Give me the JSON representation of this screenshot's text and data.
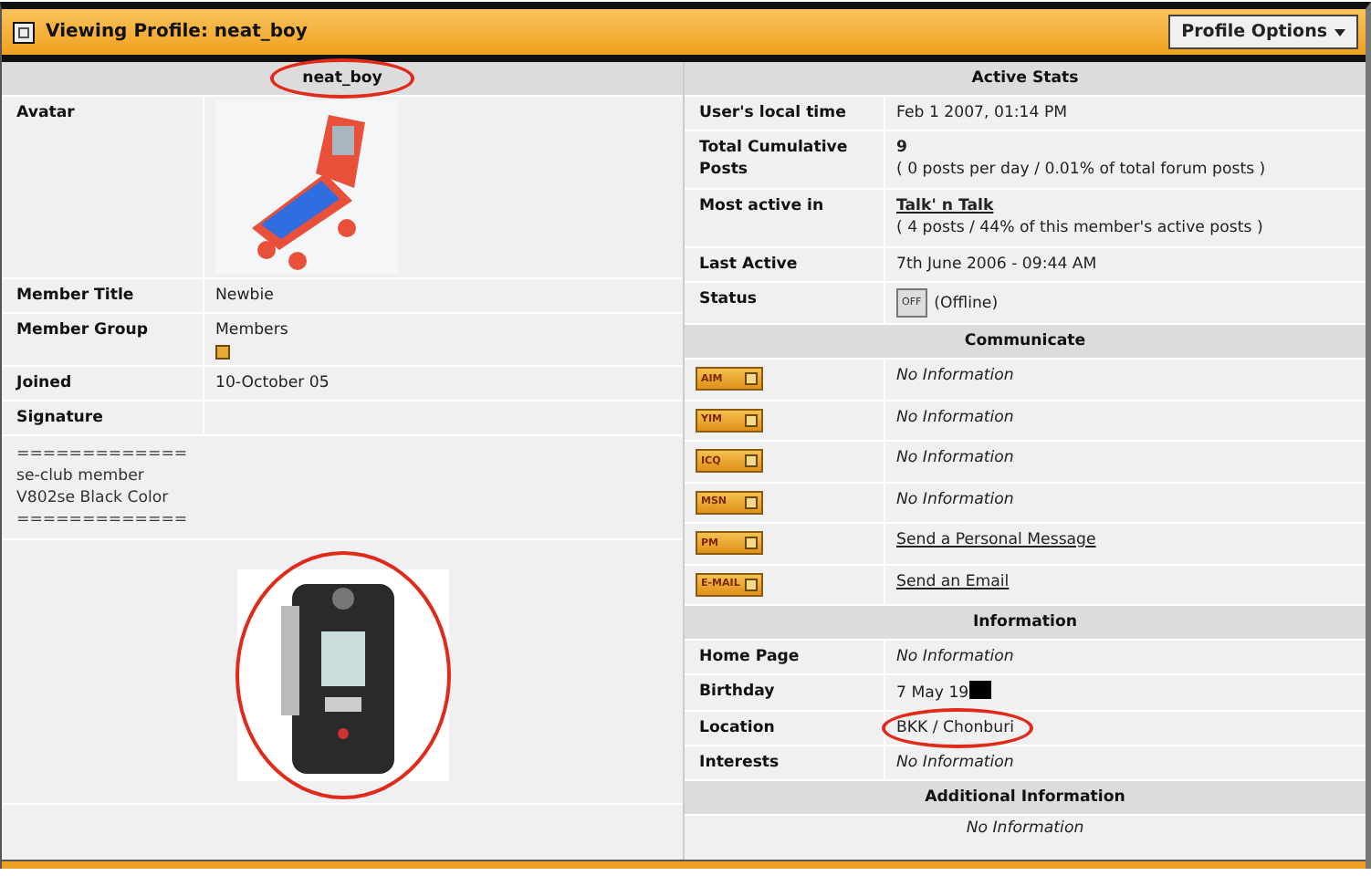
{
  "header": {
    "title": "Viewing Profile: neat_boy",
    "options_button": "Profile Options"
  },
  "profile": {
    "username": "neat_boy",
    "username_circled": true,
    "rows": [
      {
        "kind": "avatar",
        "label": "Avatar"
      },
      {
        "kind": "text",
        "label": "Member Title",
        "value": "Newbie"
      },
      {
        "kind": "group",
        "label": "Member Group",
        "value": "Members"
      },
      {
        "kind": "text",
        "label": "Joined",
        "value": "10-October 05"
      },
      {
        "kind": "label",
        "label": "Signature"
      }
    ],
    "signature_lines": [
      "=============",
      "se-club member",
      "V802se Black Color",
      "============="
    ],
    "signature_image": {
      "circled": true
    }
  },
  "active_stats": {
    "title": "Active Stats",
    "rows": [
      {
        "kind": "text",
        "label": "User's local time",
        "value": "Feb 1 2007, 01:14 PM"
      },
      {
        "kind": "posts",
        "label": "Total Cumulative Posts",
        "value": "9",
        "note": "( 0 posts per day / 0.01% of total forum posts )"
      },
      {
        "kind": "link",
        "label": "Most active in",
        "value": "Talk' n Talk",
        "note": "( 4 posts / 44% of this member's active posts )"
      },
      {
        "kind": "text",
        "label": "Last Active",
        "value": "7th June 2006 - 09:44 AM"
      },
      {
        "kind": "status",
        "label": "Status",
        "badge": "OFF",
        "value": "(Offline)",
        "online": false
      }
    ]
  },
  "communicate": {
    "title": "Communicate",
    "rows": [
      {
        "kind": "none",
        "badge": "AIM",
        "value": "No Information"
      },
      {
        "kind": "none",
        "badge": "YIM",
        "value": "No Information"
      },
      {
        "kind": "none",
        "badge": "ICQ",
        "value": "No Information"
      },
      {
        "kind": "none",
        "badge": "MSN",
        "value": "No Information"
      },
      {
        "kind": "link",
        "badge": "PM",
        "value": "Send a Personal Message"
      },
      {
        "kind": "link",
        "badge": "E-MAIL",
        "value": "Send an Email"
      }
    ]
  },
  "information": {
    "title": "Information",
    "rows": [
      {
        "kind": "none",
        "label": "Home Page",
        "value": "No Information"
      },
      {
        "kind": "redacted",
        "label": "Birthday",
        "value": "7 May 19"
      },
      {
        "kind": "text",
        "label": "Location",
        "value": "BKK / Chonburi",
        "circled": true
      },
      {
        "kind": "none",
        "label": "Interests",
        "value": "No Information"
      }
    ]
  },
  "additional": {
    "title": "Additional Information",
    "value": "No Information"
  }
}
